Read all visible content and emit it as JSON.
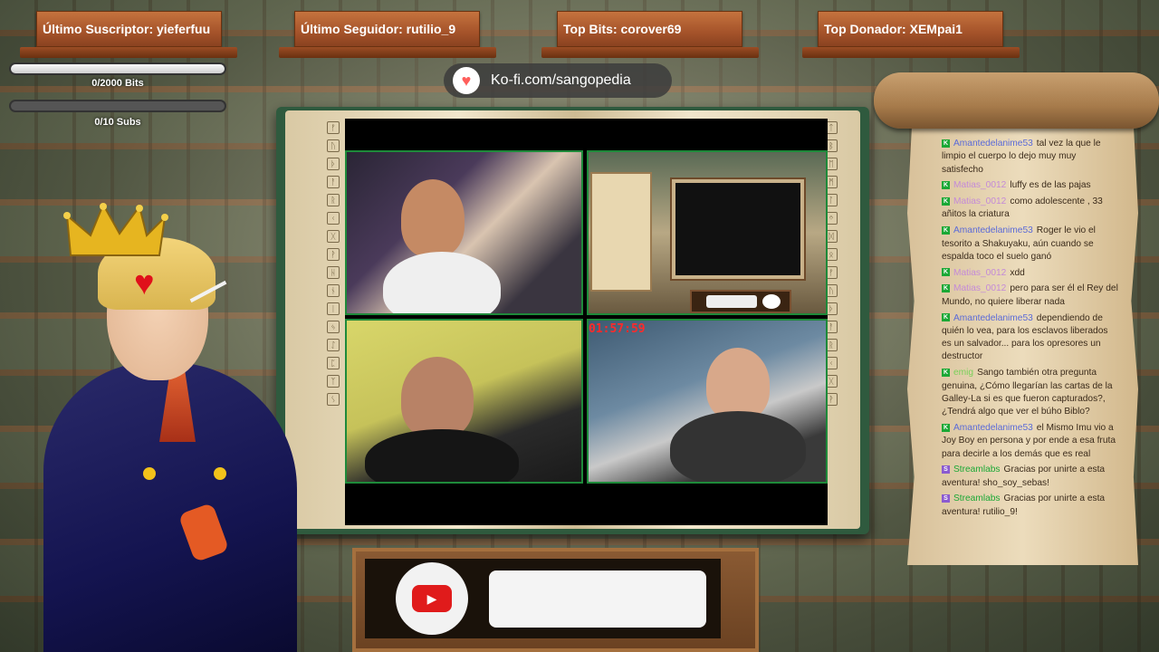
{
  "banners": {
    "last_sub": "Último Suscriptor: yieferfuu",
    "last_follower": "Último Seguidor: rutilio_9",
    "top_bits": "Top Bits: corover69",
    "top_donor": "Top Donador: XEMpai1"
  },
  "goals": {
    "bits": {
      "label": "0/2000 Bits",
      "progress": 0
    },
    "subs": {
      "label": "0/10 Subs",
      "progress": 0
    }
  },
  "kofi": {
    "text": "Ko-fi.com/sangopedia",
    "icon": "kofi-cup-icon"
  },
  "stream": {
    "timer": "01:57:59"
  },
  "colors": {
    "cam_border": "#1e8a3a",
    "timer": "#ff2a2a",
    "chat_badge": "#1aa835",
    "chat_user": "#8a5ad0",
    "youtube": "#e01b1b"
  },
  "chat": [
    {
      "user": "Amantedelanime53",
      "text": "tal vez la que le limpio el cuerpo lo dejo muy muy satisfecho",
      "color": "#5a6ad8",
      "badge": "K"
    },
    {
      "user": "Matias_0012",
      "text": "luffy es de las pajas",
      "color": "#c48ad8",
      "badge": "K"
    },
    {
      "user": "Matias_0012",
      "text": "como adolescente , 33 añitos la criatura",
      "color": "#c48ad8",
      "badge": "K"
    },
    {
      "user": "Amantedelanime53",
      "text": "Roger le vio el tesorito a Shakuyaku, aún cuando se espalda toco el suelo ganó",
      "color": "#5a6ad8",
      "badge": "K"
    },
    {
      "user": "Matias_0012",
      "text": "xdd",
      "color": "#c48ad8",
      "badge": "K"
    },
    {
      "user": "Matias_0012",
      "text": "pero para ser él el Rey del Mundo, no quiere liberar nada",
      "color": "#c48ad8",
      "badge": "K"
    },
    {
      "user": "Amantedelanime53",
      "text": "dependiendo de quién lo vea, para los esclavos liberados es un salvador... para los opresores un destructor",
      "color": "#5a6ad8",
      "badge": "K"
    },
    {
      "user": "emig",
      "text": "Sango también otra pregunta genuina, ¿Cómo llegarían las cartas de la Galley-La si es que fueron capturados?, ¿Tendrá algo que ver el búho Biblo?",
      "color": "#7ad05a",
      "badge": "K"
    },
    {
      "user": "Amantedelanime53",
      "text": "el Mismo Imu vio a Joy Boy en persona y por ende a esa fruta para decirle a los demás que es real",
      "color": "#5a6ad8",
      "badge": "K"
    },
    {
      "user": "Streamlabs",
      "text": "Gracias por unirte a esta aventura! sho_soy_sebas!",
      "color": "#1aa835",
      "badge": "S"
    },
    {
      "user": "Streamlabs",
      "text": "Gracias por unirte a esta aventura! rutilio_9!",
      "color": "#1aa835",
      "badge": "S"
    }
  ],
  "youtube": {
    "icon": "youtube-play-icon",
    "play": "▶"
  }
}
